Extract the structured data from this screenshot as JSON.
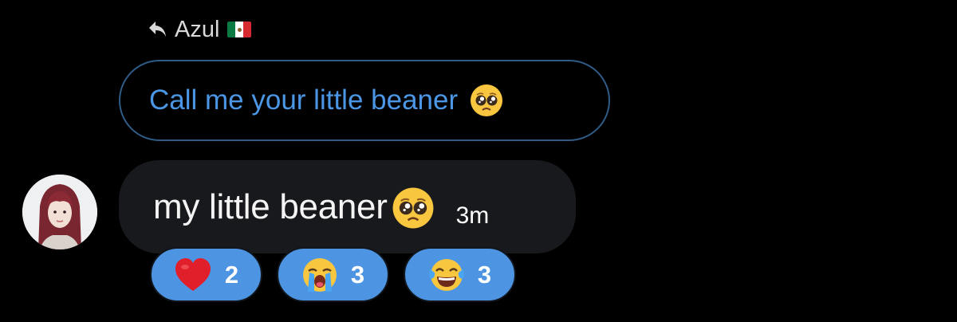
{
  "reply_header": {
    "author": "Azul",
    "flag_icon": "mexico-flag-icon",
    "reply_icon": "reply-arrow-icon"
  },
  "quoted_message": {
    "text": "Call me your little beaner",
    "emoji": "pleading-face-emoji",
    "color": "#4b97e5"
  },
  "message": {
    "text": "my little beaner",
    "emoji": "pleading-face-emoji",
    "timestamp": "3m"
  },
  "reactions": [
    {
      "emoji": "red-heart-emoji",
      "count": "2"
    },
    {
      "emoji": "loudly-crying-face-emoji",
      "count": "3"
    },
    {
      "emoji": "face-with-tears-of-joy-emoji",
      "count": "3"
    }
  ],
  "colors": {
    "background": "#000000",
    "bubble": "#18191d",
    "reaction_pill": "#4d95e3",
    "quote_border": "#2f5b86"
  }
}
